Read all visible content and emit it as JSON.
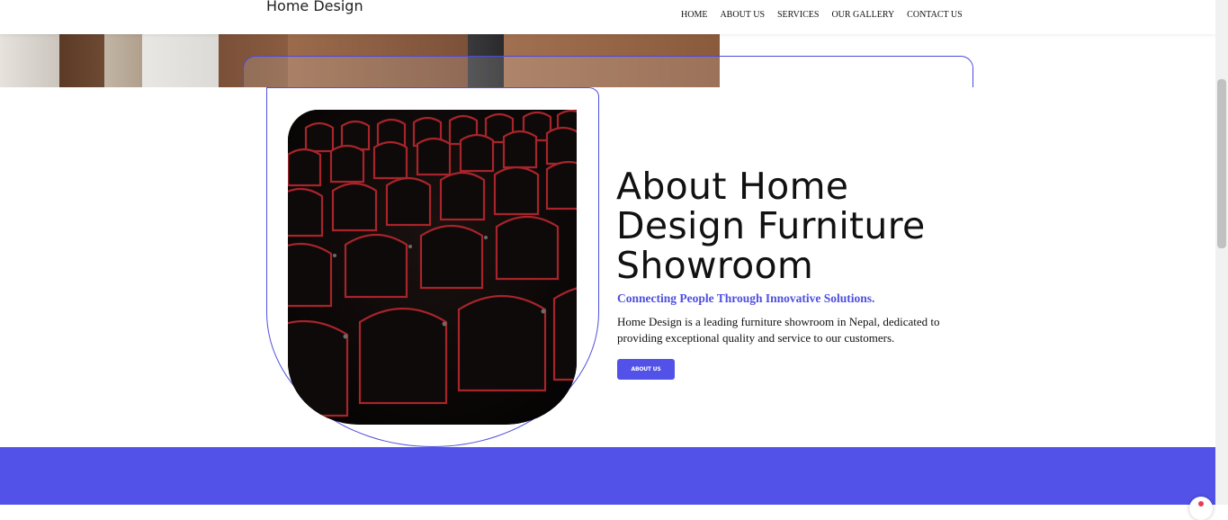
{
  "header": {
    "brand": "Home Design",
    "nav": [
      "HOME",
      "ABOUT US",
      "SERVICES",
      "OUR GALLERY",
      "CONTACT US"
    ]
  },
  "about": {
    "title": "About Home Design Furniture Showroom",
    "subtitle": "Connecting People Through Innovative Solutions.",
    "description": "Home Design is a leading furniture showroom in Nepal, dedicated to providing exceptional quality and service to our customers.",
    "button_label": "ABOUT US"
  },
  "colors": {
    "accent": "#5252e8",
    "text": "#111111",
    "background": "#ffffff"
  },
  "icons": {
    "chat": "chat-bubble-icon"
  }
}
